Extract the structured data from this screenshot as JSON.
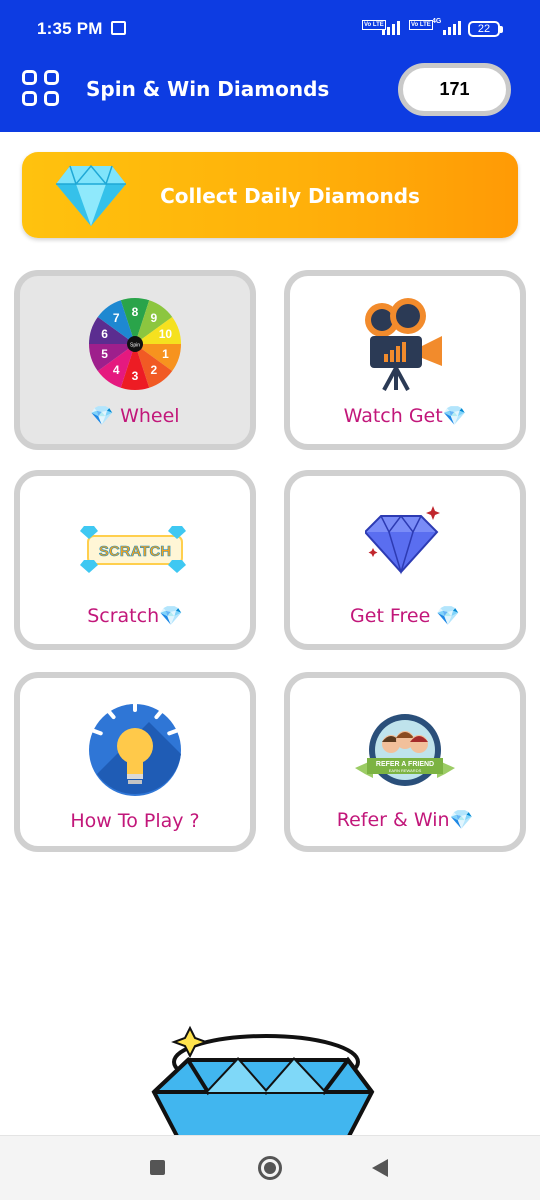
{
  "status_bar": {
    "time": "1:35 PM",
    "battery": "22",
    "net_label_1": "Vo LTE",
    "net_label_2": "Vo LTE",
    "net_type": "4G"
  },
  "header": {
    "title": "Spin & Win Diamonds",
    "diamond_count": "171"
  },
  "collect_banner": {
    "label": "Collect Daily Diamonds"
  },
  "cards": [
    {
      "label": "💎 Wheel"
    },
    {
      "label": "Watch Get💎"
    },
    {
      "label": "Scratch💎"
    },
    {
      "label": "Get Free 💎"
    },
    {
      "label": "How To Play ?"
    },
    {
      "label": "Refer & Win💎"
    }
  ],
  "artwork_text": {
    "wheel_center": "Spin",
    "wheel_numbers": [
      "8",
      "9",
      "10",
      "1",
      "2",
      "3",
      "4",
      "5",
      "6",
      "7"
    ],
    "scratch": "SCRATCH",
    "refer_top": "REFER A FRIEND",
    "refer_bottom": "EARN REWARDS"
  },
  "colors": {
    "header": "#0d3ce2",
    "accent_text": "#c2177a",
    "banner_start": "#ffc20e",
    "banner_end": "#ff9a05"
  },
  "icons": [
    "menu-grid-icon",
    "diamond-icon",
    "spin-wheel-icon",
    "movie-camera-icon",
    "scratch-card-icon",
    "diamond-sparkle-icon",
    "lightbulb-icon",
    "refer-friend-badge-icon"
  ]
}
